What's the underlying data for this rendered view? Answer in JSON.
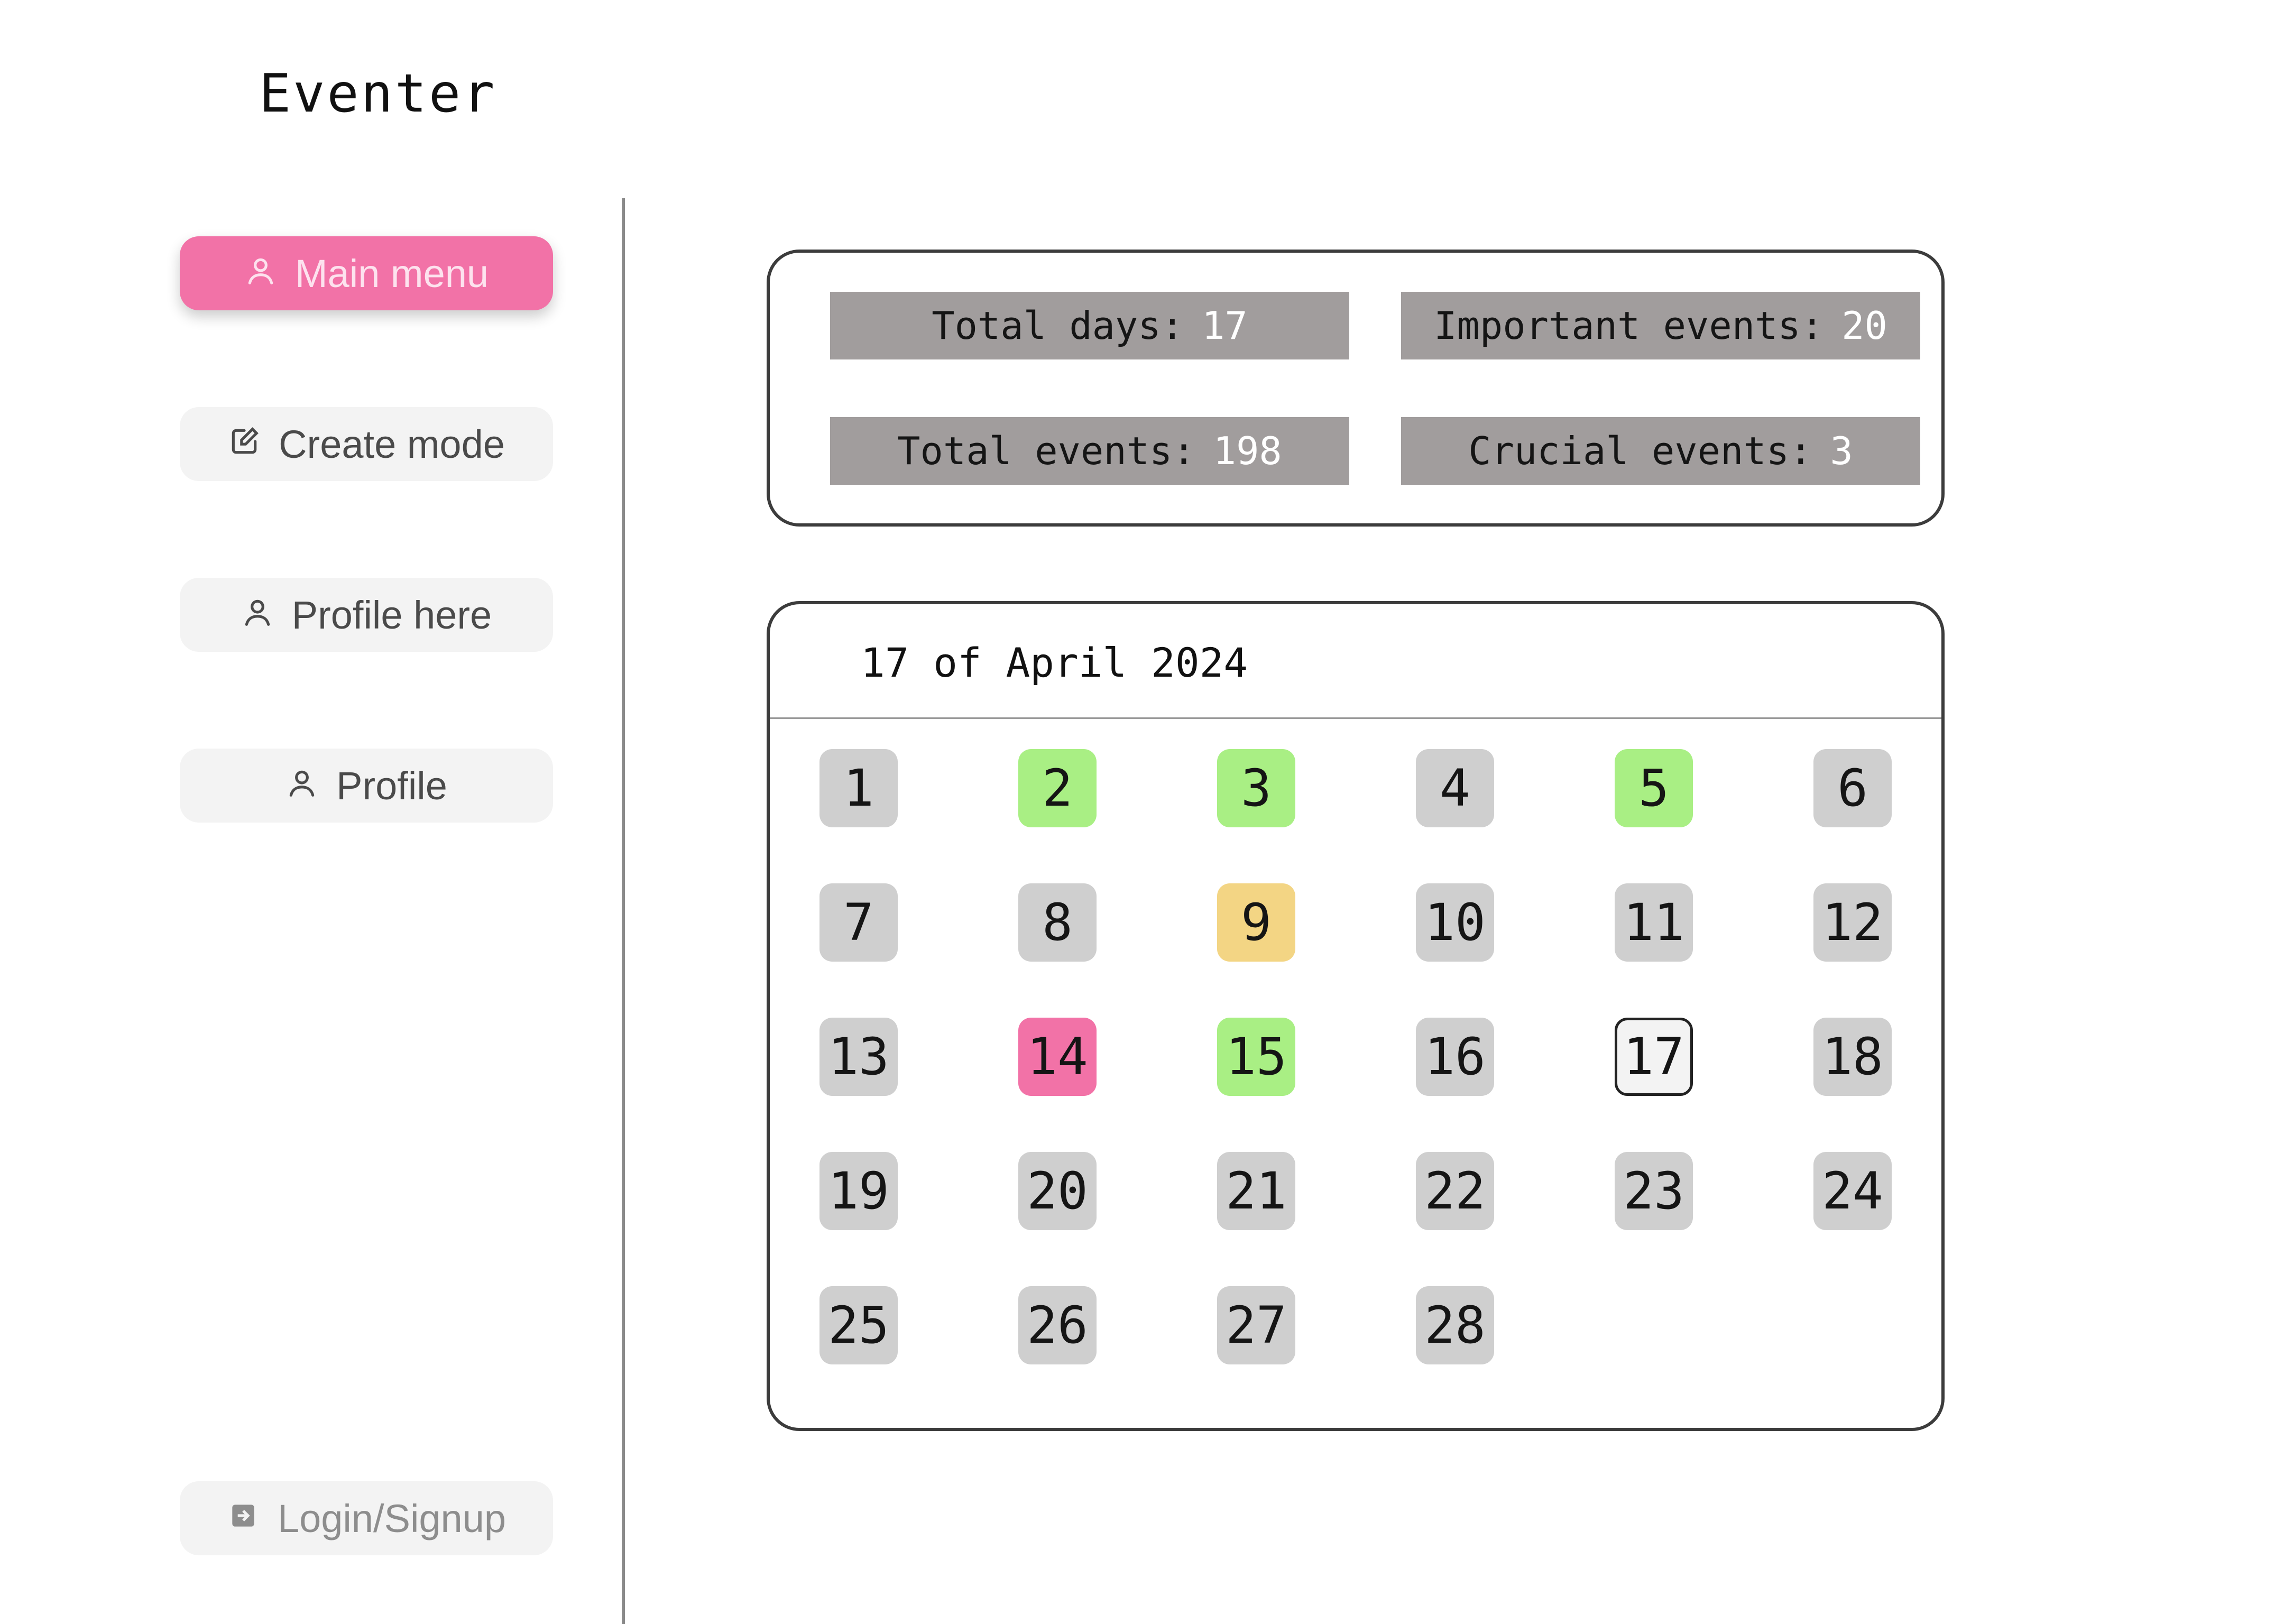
{
  "app": {
    "title": "Eventer"
  },
  "nav": [
    {
      "label": "Main menu",
      "icon": "user-icon",
      "state": "active"
    },
    {
      "label": "Create mode",
      "icon": "edit-icon",
      "state": "default"
    },
    {
      "label": "Profile here",
      "icon": "user-icon",
      "state": "default"
    },
    {
      "label": "Profile",
      "icon": "user-icon",
      "state": "default"
    }
  ],
  "auth": {
    "label": "Login/Signup",
    "icon": "login-icon"
  },
  "stats": {
    "total_days": {
      "label": "Total days:",
      "value": "17"
    },
    "important_events": {
      "label": "Important events:",
      "value": "20"
    },
    "total_events": {
      "label": "Total events:",
      "value": "198"
    },
    "crucial_events": {
      "label": "Crucial events:",
      "value": "3"
    }
  },
  "calendar": {
    "header": "17 of April 2024",
    "days": [
      {
        "n": "1",
        "status": "default"
      },
      {
        "n": "2",
        "status": "green"
      },
      {
        "n": "3",
        "status": "green"
      },
      {
        "n": "4",
        "status": "default"
      },
      {
        "n": "5",
        "status": "green"
      },
      {
        "n": "6",
        "status": "default"
      },
      {
        "n": "7",
        "status": "default"
      },
      {
        "n": "8",
        "status": "default"
      },
      {
        "n": "9",
        "status": "yellow"
      },
      {
        "n": "10",
        "status": "default"
      },
      {
        "n": "11",
        "status": "default"
      },
      {
        "n": "12",
        "status": "default"
      },
      {
        "n": "13",
        "status": "default"
      },
      {
        "n": "14",
        "status": "pink"
      },
      {
        "n": "15",
        "status": "green"
      },
      {
        "n": "16",
        "status": "default"
      },
      {
        "n": "17",
        "status": "current"
      },
      {
        "n": "18",
        "status": "default"
      },
      {
        "n": "19",
        "status": "default"
      },
      {
        "n": "20",
        "status": "default"
      },
      {
        "n": "21",
        "status": "default"
      },
      {
        "n": "22",
        "status": "default"
      },
      {
        "n": "23",
        "status": "default"
      },
      {
        "n": "24",
        "status": "default"
      },
      {
        "n": "25",
        "status": "default"
      },
      {
        "n": "26",
        "status": "default"
      },
      {
        "n": "27",
        "status": "default"
      },
      {
        "n": "28",
        "status": "default"
      }
    ]
  },
  "colors": {
    "accent": "#f272a7",
    "green": "#a9ef84",
    "yellow": "#f3d584",
    "day_default": "#cfcfcf",
    "stat_bg": "#a19d9d"
  }
}
